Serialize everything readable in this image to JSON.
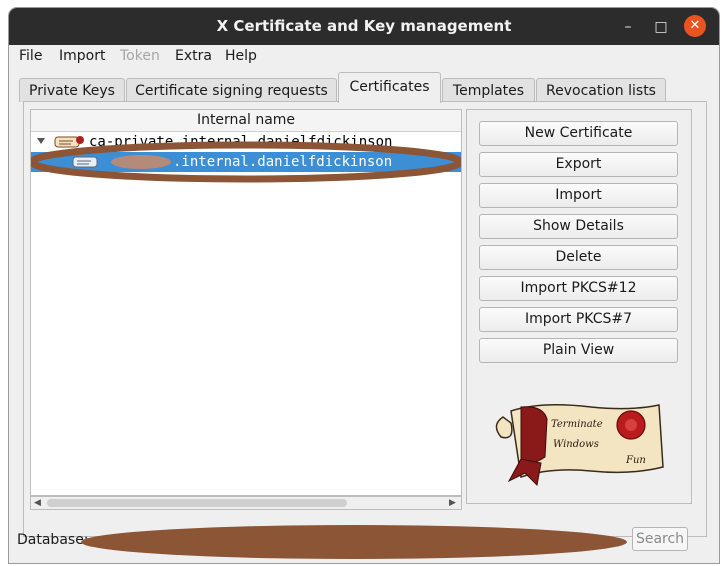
{
  "window": {
    "title": "X Certificate and Key management",
    "min_glyph": "–",
    "max_glyph": "□",
    "close_glyph": "✕"
  },
  "menubar": {
    "items": [
      {
        "label": "File",
        "disabled": false
      },
      {
        "label": "Import",
        "disabled": false
      },
      {
        "label": "Token",
        "disabled": true
      },
      {
        "label": "Extra",
        "disabled": false
      },
      {
        "label": "Help",
        "disabled": false
      }
    ]
  },
  "tabs": [
    {
      "label": "Private Keys"
    },
    {
      "label": "Certificate signing requests"
    },
    {
      "label": "Certificates",
      "active": true
    },
    {
      "label": "Templates"
    },
    {
      "label": "Revocation lists"
    }
  ],
  "tree": {
    "header": "Internal name",
    "rows": [
      {
        "text": "ca-private.internal.danielfdickinson",
        "expanded": true,
        "selected": false
      },
      {
        "text": ".internal.danielfdickinson",
        "expanded": false,
        "selected": true
      }
    ]
  },
  "buttons": [
    {
      "label": "New Certificate"
    },
    {
      "label": "Export"
    },
    {
      "label": "Import"
    },
    {
      "label": "Show Details"
    },
    {
      "label": "Delete"
    },
    {
      "label": "Import PKCS#12"
    },
    {
      "label": "Import PKCS#7"
    },
    {
      "label": "Plain View"
    }
  ],
  "logo": {
    "line1": "Terminate",
    "line2": "Windows",
    "line3": "Fun"
  },
  "status": {
    "database_label": "Database:",
    "search_label": "Search"
  },
  "colors": {
    "titlebar": "#2c2c2c",
    "close_button": "#e95420",
    "selection": "#3c8fd4",
    "redaction": "#8c5536"
  }
}
